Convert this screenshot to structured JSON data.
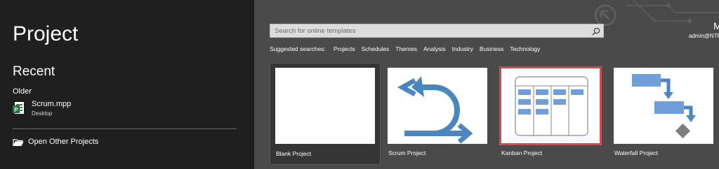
{
  "sidebar": {
    "app_title": "Project",
    "recent_heading": "Recent",
    "older_label": "Older",
    "recent_files": [
      {
        "name": "Scrum.mpp",
        "location": "Desktop",
        "icon": "project-file-icon"
      }
    ],
    "open_other_label": "Open Other Projects"
  },
  "search": {
    "placeholder": "Search for online templates"
  },
  "suggested": {
    "label": "Suggested searches:",
    "items": [
      "Projects",
      "Schedules",
      "Themes",
      "Analysis",
      "Industry",
      "Business",
      "Technology"
    ]
  },
  "account": {
    "initial": "M",
    "email": "admin@NTP"
  },
  "templates": [
    {
      "label": "Blank Project"
    },
    {
      "label": "Scrum Project"
    },
    {
      "label": "Kanban Project"
    },
    {
      "label": "Waterfall Project"
    }
  ],
  "colors": {
    "sidebar_bg": "#1f1f1f",
    "main_bg": "#4a4a4a",
    "accent_blue": "#4a86c0",
    "selection_red": "#d24a4a"
  }
}
